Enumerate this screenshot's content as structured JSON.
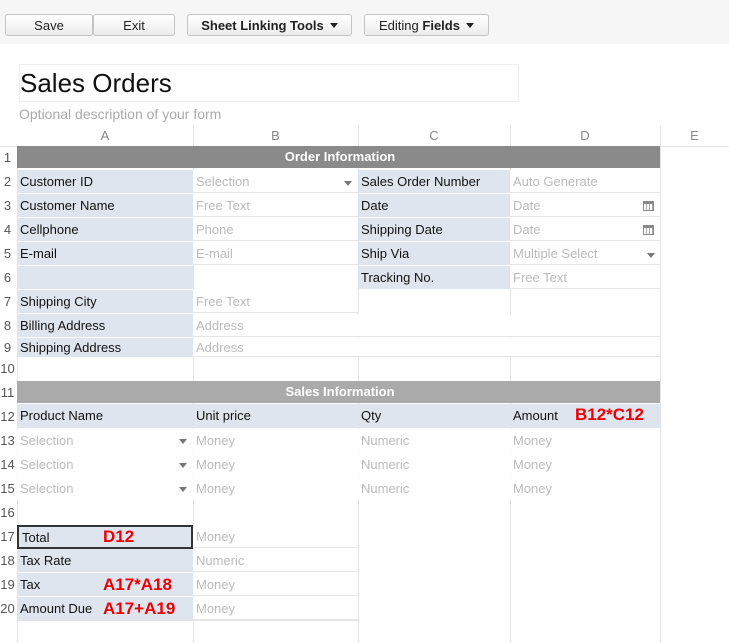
{
  "toolbar": {
    "save_label": "Save",
    "exit_label": "Exit",
    "linking_label": "Sheet Linking Tools",
    "editing_prefix": "Editing",
    "editing_bold": "Fields"
  },
  "form": {
    "title": "Sales Orders",
    "description": "Optional description of your form"
  },
  "columns": [
    "A",
    "B",
    "C",
    "D",
    "E"
  ],
  "rows": [
    "1",
    "2",
    "3",
    "4",
    "5",
    "6",
    "7",
    "8",
    "9",
    "10",
    "11",
    "12",
    "13",
    "14",
    "15",
    "16",
    "17",
    "18",
    "19",
    "20"
  ],
  "order_info": {
    "header": "Order Information",
    "customer_id": "Customer ID",
    "customer_id_field": "Selection",
    "sales_order_number": "Sales Order Number",
    "sales_order_number_field": "Auto Generate",
    "customer_name": "Customer Name",
    "customer_name_field": "Free Text",
    "date": "Date",
    "date_field": "Date",
    "cellphone": "Cellphone",
    "cellphone_field": "Phone",
    "shipping_date": "Shipping Date",
    "shipping_date_field": "Date",
    "email": "E-mail",
    "email_field": "E-mail",
    "ship_via": "Ship Via",
    "ship_via_field": "Multiple Select",
    "tracking_no": "Tracking No.",
    "tracking_no_field": "Free Text",
    "shipping_city": "Shipping City",
    "shipping_city_field": "Free Text",
    "billing_address": "Billing Address",
    "billing_address_field": "Address",
    "shipping_address": "Shipping Address",
    "shipping_address_field": "Address"
  },
  "sales_info": {
    "header": "Sales Information",
    "product_name": "Product Name",
    "unit_price": "Unit price",
    "qty": "Qty",
    "amount": "Amount",
    "amount_formula": "B12*C12",
    "line_items": [
      {
        "product": "Selection",
        "price": "Money",
        "qty": "Numeric",
        "amount": "Money"
      },
      {
        "product": "Selection",
        "price": "Money",
        "qty": "Numeric",
        "amount": "Money"
      },
      {
        "product": "Selection",
        "price": "Money",
        "qty": "Numeric",
        "amount": "Money"
      }
    ]
  },
  "totals": {
    "total": "Total",
    "total_formula": "D12",
    "total_field": "Money",
    "tax_rate": "Tax Rate",
    "tax_rate_field": "Numeric",
    "tax": "Tax",
    "tax_formula": "A17*A18",
    "tax_field": "Money",
    "amount_due": "Amount Due",
    "amount_due_formula": "A17+A19",
    "amount_due_field": "Money"
  },
  "colors": {
    "label_bg": "#dfe5ef",
    "section_header": "#8a8a8a",
    "formula_text": "#ee0000"
  }
}
